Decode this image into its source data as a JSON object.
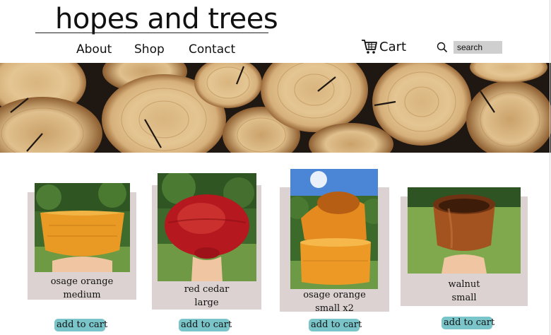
{
  "site": {
    "logo": "hopes and trees"
  },
  "nav": {
    "about": "About",
    "shop": "Shop",
    "contact": "Contact"
  },
  "header": {
    "cart_label": "Cart",
    "search_placeholder": "search"
  },
  "products": [
    {
      "name_line1": "osage orange",
      "name_line2": "medium",
      "button": "add to cart"
    },
    {
      "name_line1": "red cedar",
      "name_line2": "large",
      "button": "add to cart"
    },
    {
      "name_line1": "osage orange",
      "name_line2": "small x2",
      "button": "add to cart"
    },
    {
      "name_line1": "walnut",
      "name_line2": "small",
      "button": "add to cart"
    }
  ],
  "colors": {
    "card_bg": "#dcd2d1",
    "button_bg": "#79c5ca",
    "search_bg": "#cfcfcf"
  }
}
